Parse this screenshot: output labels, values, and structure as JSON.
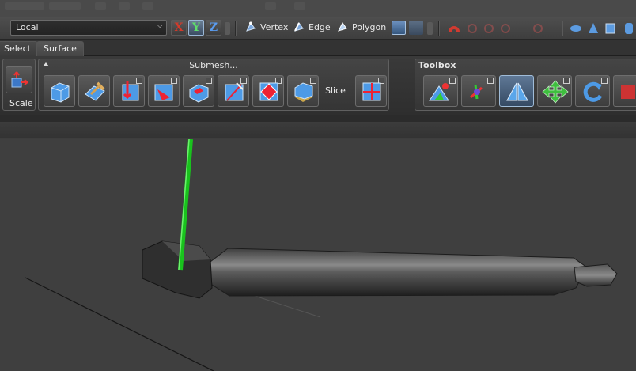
{
  "toolbar": {
    "coord_space": "Local",
    "axes": [
      "X",
      "Y",
      "Z"
    ],
    "modes": {
      "vertex": "Vertex",
      "edge": "Edge",
      "polygon": "Polygon"
    }
  },
  "tabs": [
    {
      "label": "Select",
      "active": false
    },
    {
      "label": "Surface",
      "active": true
    }
  ],
  "ribbon": {
    "transform_group": {
      "scale_label": "Scale"
    },
    "submesh_group": {
      "title": "Submesh...",
      "slice_label": "Slice"
    },
    "toolbox_group": {
      "title": "Toolbox"
    }
  },
  "icons": {
    "x_axis": "x-axis-icon",
    "y_axis": "y-axis-icon",
    "z_axis": "z-axis-icon",
    "vertex": "vertex-mode-icon",
    "edge": "edge-mode-icon",
    "polygon": "polygon-mode-icon",
    "scale": "scale-icon"
  },
  "colors": {
    "axis_x": "#d23a2a",
    "axis_y": "#2bbf3a",
    "axis_z": "#3c7ad8",
    "gizmo_y": "#19c31d",
    "accent": "#4f87c7"
  }
}
